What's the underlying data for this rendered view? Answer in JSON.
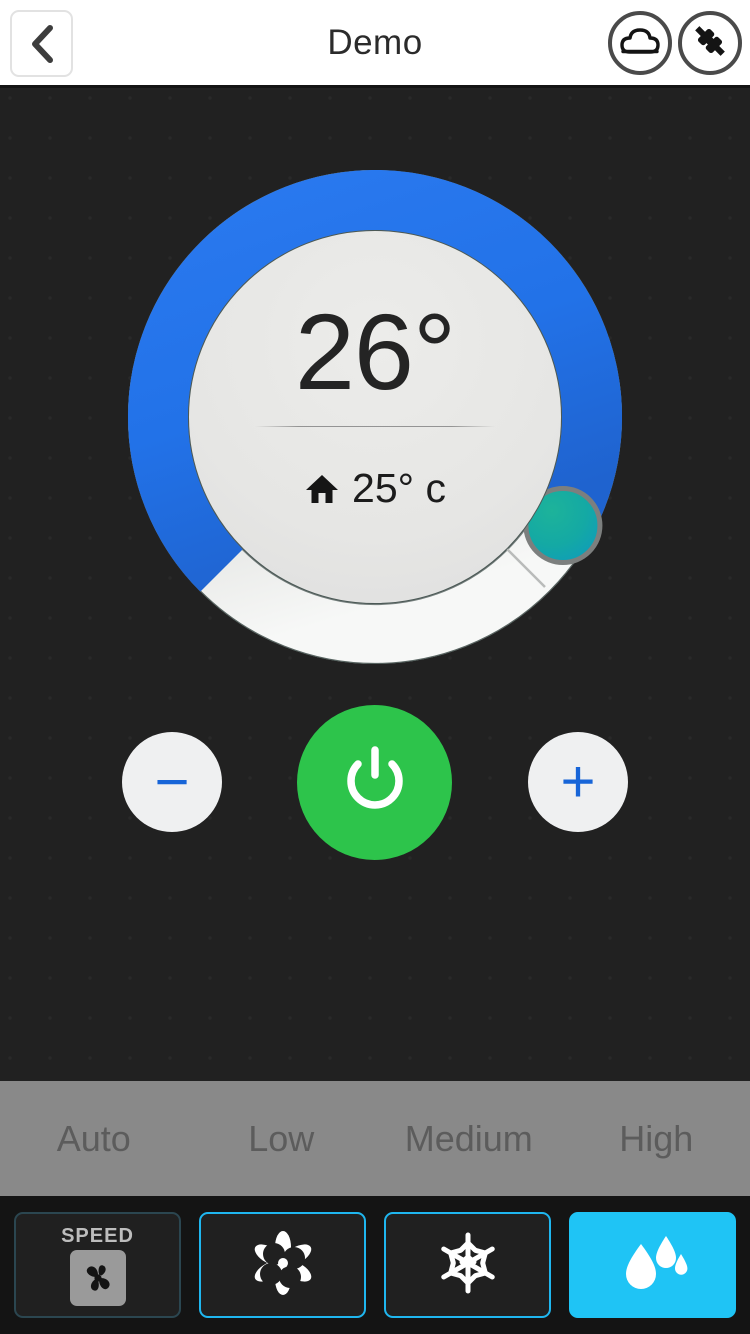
{
  "header": {
    "title": "Demo",
    "back_label": "Back",
    "back_icon": "chevron-left-icon",
    "cloud_icon": "cloud-icon",
    "plug_icon": "plug-icon"
  },
  "dial": {
    "set_temperature": "26°",
    "ambient_temperature": "25° c",
    "home_icon": "home-icon",
    "arc_color": "#2272e8",
    "track_color": "#f4f4f4",
    "thumb_color": "#17b0a4",
    "arc_start_deg": 225,
    "arc_sweep_deg": 255,
    "thumb_angle_deg": 120,
    "center_bg": "#e8e8e6"
  },
  "controls": {
    "decrease_label": "−",
    "decrease_name": "minus-icon",
    "increase_label": "+",
    "increase_name": "plus-icon",
    "power_icon": "power-icon",
    "power_color": "#2dc44b",
    "glyph_color": "#1765d8"
  },
  "fan_speed": {
    "options": [
      {
        "label": "Auto"
      },
      {
        "label": "Low"
      },
      {
        "label": "Medium"
      },
      {
        "label": "High"
      }
    ],
    "bar_color": "#898989",
    "text_color": "#5c5c5c"
  },
  "toolbar": {
    "items": [
      {
        "id": "speed",
        "label": "SPEED",
        "icon": "fan-speed-icon",
        "state": "dim"
      },
      {
        "id": "fan",
        "label": "",
        "icon": "fan-blades-icon",
        "state": "outline"
      },
      {
        "id": "cool",
        "label": "",
        "icon": "snowflake-icon",
        "state": "outline"
      },
      {
        "id": "humidity",
        "label": "",
        "icon": "water-drops-icon",
        "state": "active"
      }
    ],
    "accent_color": "#1fc4f5"
  }
}
